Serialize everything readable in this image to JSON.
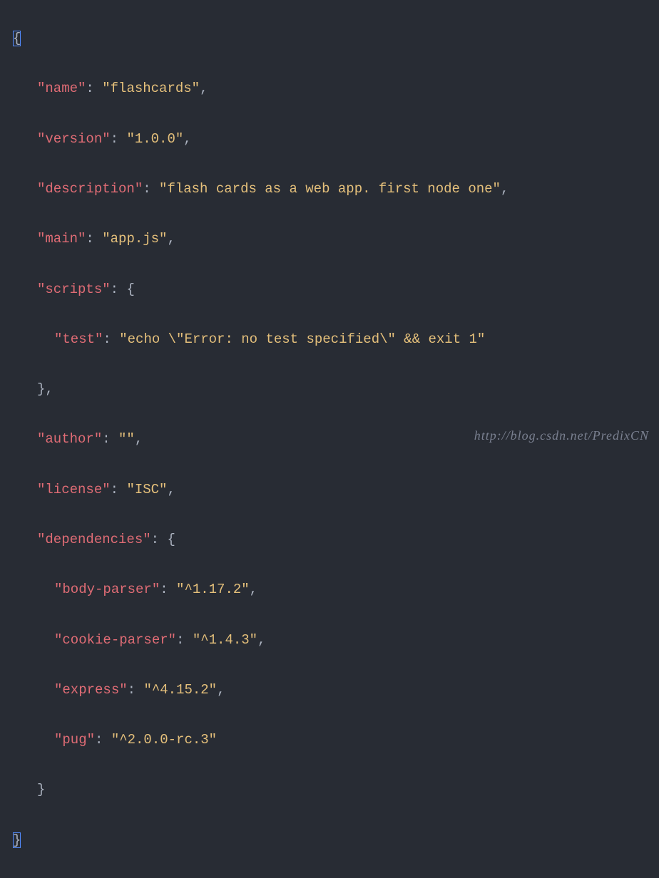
{
  "json": {
    "keys": {
      "name": "\"name\"",
      "version": "\"version\"",
      "description": "\"description\"",
      "main": "\"main\"",
      "scripts": "\"scripts\"",
      "test": "\"test\"",
      "author": "\"author\"",
      "license": "\"license\"",
      "dependencies": "\"dependencies\"",
      "body_parser": "\"body-parser\"",
      "cookie_parser": "\"cookie-parser\"",
      "express": "\"express\"",
      "pug": "\"pug\""
    },
    "values": {
      "name": "\"flashcards\"",
      "version": "\"1.0.0\"",
      "description": "\"flash cards as a web app. first node one\"",
      "main": "\"app.js\"",
      "test": "\"echo \\\"Error: no test specified\\\" && exit 1\"",
      "author": "\"\"",
      "license": "\"ISC\"",
      "body_parser": "\"^1.17.2\"",
      "cookie_parser": "\"^1.4.3\"",
      "express": "\"^4.15.2\"",
      "pug": "\"^2.0.0-rc.3\""
    },
    "punct": {
      "open_brace": "{",
      "close_brace": "}",
      "colon_space": ": ",
      "comma": ","
    }
  },
  "watermark": "http://blog.csdn.net/PredixCN"
}
